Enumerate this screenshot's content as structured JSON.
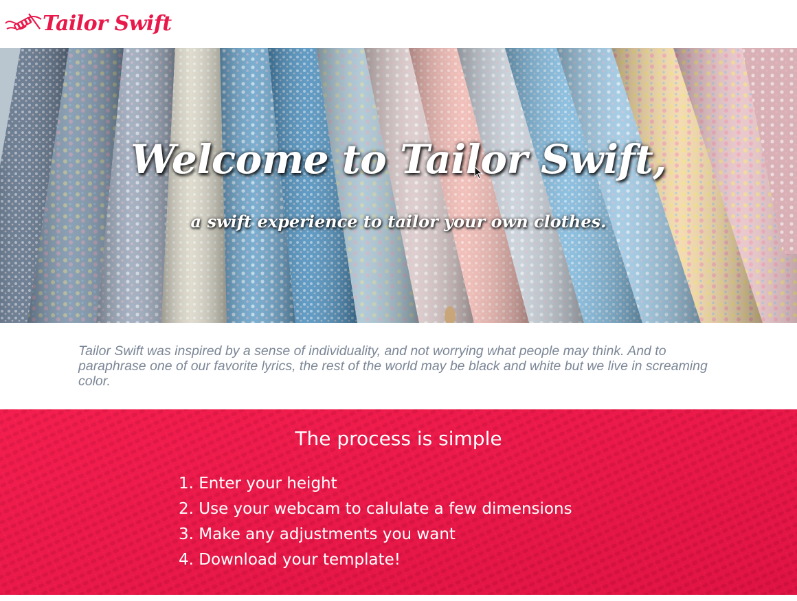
{
  "header": {
    "brand_name": "Tailor Swift",
    "brand_icon": "needle-thread-icon",
    "brand_color": "#e8184a"
  },
  "hero": {
    "title": "Welcome to Tailor Swift,",
    "subtitle": "a swift experience to tailor your own clothes.",
    "background": "rolled-fabric-photo"
  },
  "intro": {
    "text": "Tailor Swift was inspired by a sense of individuality, and not worrying what people may think. And to paraphrase one of our favorite lyrics, the rest of the world may be black and white but we live in screaming color."
  },
  "process": {
    "title": "The process is simple",
    "background_color": "#ef1a4a",
    "steps": [
      "1. Enter your height",
      "2. Use your webcam to calulate a few dimensions",
      "3. Make any adjustments you want",
      "4. Download your template!"
    ]
  }
}
